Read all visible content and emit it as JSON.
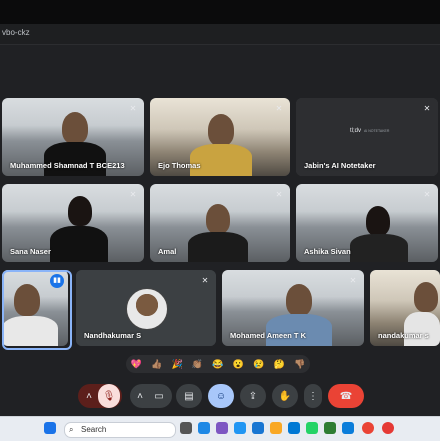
{
  "browser": {
    "url_fragment": "vbo-ckz"
  },
  "participants": [
    {
      "name": "Muhammed Shamnad T BCE213",
      "muted": true
    },
    {
      "name": "Ejo Thomas",
      "muted": true
    },
    {
      "name": "Jabin's AI Notetaker",
      "muted": true,
      "logo": "tl;dv",
      "badge": "AI NOTETAKER"
    },
    {
      "name": "Sana Naser",
      "muted": true
    },
    {
      "name": "Amal",
      "muted": true
    },
    {
      "name": "Ashika Sivan",
      "muted": true
    },
    {
      "name": "",
      "muted": false,
      "speaking": true
    },
    {
      "name": "Nandhakumar S",
      "muted": true
    },
    {
      "name": "Mohamed Ameen T K",
      "muted": true
    },
    {
      "name": "nandakumar s",
      "muted": false
    }
  ],
  "reactions": [
    "💖",
    "👍🏽",
    "🎉",
    "👏🏽",
    "😂",
    "😮",
    "😢",
    "🤔",
    "👎🏽"
  ],
  "controls": {
    "mic": "mic-off-icon",
    "camera": "camera-icon",
    "captions": "captions-icon",
    "emoji": "emoji-icon",
    "present": "present-icon",
    "raise_hand": "hand-icon",
    "more": "more-icon",
    "leave": "leave-call-icon"
  },
  "taskbar": {
    "search_label": "Search"
  },
  "colors": {
    "leave": "#ea4335",
    "mic_off": "#f9dedc",
    "emoji_active": "#a8c7fa",
    "speaker_ring": "#8ab4f8"
  }
}
